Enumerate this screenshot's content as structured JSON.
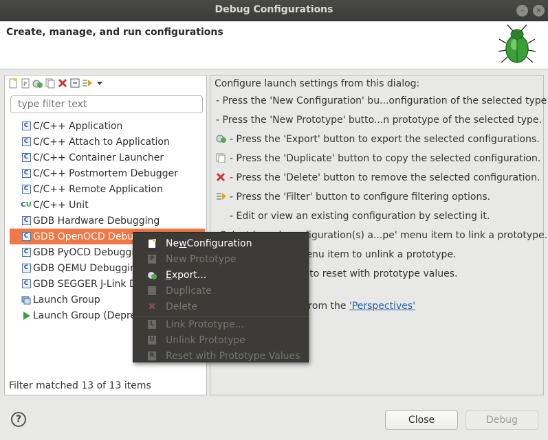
{
  "window": {
    "title": "Debug Configurations"
  },
  "header": {
    "title": "Create, manage, and run configurations",
    "logo_icon": "debug-bug-icon"
  },
  "toolbar": {
    "icons": [
      "new-configuration-icon",
      "new-prototype-icon",
      "export-icon",
      "duplicate-icon",
      "delete-icon",
      "collapse-all-icon",
      "filter-icon",
      "view-menu-icon"
    ]
  },
  "filter": {
    "placeholder": "type filter text"
  },
  "tree": {
    "items": [
      {
        "label": "C/C++ Application",
        "icon": "c-app-icon"
      },
      {
        "label": "C/C++ Attach to Application",
        "icon": "c-app-icon"
      },
      {
        "label": "C/C++ Container Launcher",
        "icon": "c-app-icon"
      },
      {
        "label": "C/C++ Postmortem Debugger",
        "icon": "c-app-icon"
      },
      {
        "label": "C/C++ Remote Application",
        "icon": "c-app-icon"
      },
      {
        "label": "C/C++ Unit",
        "icon": "c-unit-icon"
      },
      {
        "label": "GDB Hardware Debugging",
        "icon": "c-app-icon"
      },
      {
        "label": "GDB OpenOCD Debugging",
        "icon": "c-app-icon",
        "selected": true
      },
      {
        "label": "GDB PyOCD Debugging",
        "icon": "c-app-icon"
      },
      {
        "label": "GDB QEMU Debugging",
        "icon": "c-app-icon"
      },
      {
        "label": "GDB SEGGER J-Link Debugging",
        "icon": "c-app-icon"
      },
      {
        "label": "Launch Group",
        "icon": "launch-group-icon"
      },
      {
        "label": "Launch Group (Deprecated)",
        "icon": "run-icon"
      }
    ],
    "status": "Filter matched 13 of 13 items"
  },
  "info": {
    "intro": "Configure launch settings from this dialog:",
    "lines": [
      "- Press the 'New Configuration' bu...onfiguration of the selected type.",
      "- Press the 'New Prototype' butto...n prototype of the selected type.",
      "- Press the 'Export' button to export the selected configurations.",
      "- Press the 'Duplicate' button to copy the selected configuration.",
      "- Press the 'Delete' button to remove the selected configuration.",
      "- Press the 'Filter' button to configure filtering options.",
      "- Edit or view an existing configuration by selecting it.",
      "- Select launch configuration(s) a...pe' menu item to link a prototype.",
      "- Select launch configuration(s) a...' menu item to unlink a prototype.",
      "- Select launch configuration(s) a...em to reset with prototype values."
    ],
    "perspectives_prefix": "Configure launch perspective settings from the ",
    "perspectives_link": "'Perspectives'",
    "visible_fragments": {
      "link_line": "pe' menu item to link a prototype.",
      "unlink_line": "guration(s) a...' menu item to unlink a prototype.",
      "reset_line": "guration(s) a...em to reset with prototype values.",
      "select_prefix": "Select launch configuration(s) a...",
      "persp_prefix": "spective settings from the "
    }
  },
  "context_menu": {
    "items": [
      {
        "pre": "Ne",
        "mnemonic": "w",
        "post": " Configuration",
        "enabled": true,
        "icon": "new-configuration-icon"
      },
      {
        "pre": "New Prototype",
        "mnemonic": "",
        "post": "",
        "enabled": false,
        "icon": "new-prototype-icon"
      },
      {
        "pre": "",
        "mnemonic": "E",
        "post": "xport...",
        "enabled": true,
        "icon": "export-icon"
      },
      {
        "pre": "Duplicate",
        "mnemonic": "",
        "post": "",
        "enabled": false,
        "icon": "duplicate-icon"
      },
      {
        "pre": "Delete",
        "mnemonic": "",
        "post": "",
        "enabled": false,
        "icon": "delete-icon"
      },
      {
        "pre": "Link Prototype...",
        "mnemonic": "",
        "post": "",
        "enabled": false,
        "icon": "link-prototype-icon"
      },
      {
        "pre": "Unlink Prototype",
        "mnemonic": "",
        "post": "",
        "enabled": false,
        "icon": "unlink-prototype-icon"
      },
      {
        "pre": "Reset with Prototype Values",
        "mnemonic": "",
        "post": "",
        "enabled": false,
        "icon": "reset-prototype-icon"
      }
    ]
  },
  "buttons": {
    "close": "Close",
    "debug": "Debug",
    "help": "?"
  }
}
